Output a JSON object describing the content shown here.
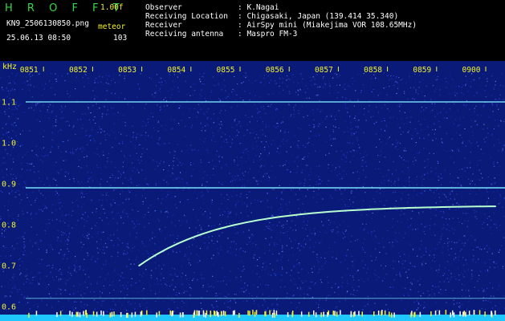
{
  "header": {
    "logo": "H R O F F T",
    "version": "1.00f",
    "filename": "KN9_2506130850.png",
    "datetime": "25.06.13 08:50",
    "mode_label": "meteor",
    "mode_value": "103",
    "info": [
      {
        "label": "Observer",
        "value": ": K.Nagai"
      },
      {
        "label": "Receiving Location",
        "value": ": Chigasaki, Japan (139.414 35.340)"
      },
      {
        "label": "Receiver",
        "value": ": AirSpy mini (Miakejima VOR 108.65MHz)"
      },
      {
        "label": "Receiving antenna",
        "value": ": Maspro FM-3"
      }
    ]
  },
  "spectrogram": {
    "unit_label": "kHz",
    "time_labels": [
      "0851",
      "0852",
      "0853",
      "0854",
      "0855",
      "0856",
      "0857",
      "0858",
      "0859",
      "0900"
    ],
    "freq_labels": [
      "1.1",
      "1.0",
      "0.9",
      "0.8",
      "0.7",
      "0.6"
    ],
    "freq_ticks": [
      1.1,
      1.0,
      0.9,
      0.8,
      0.7,
      0.6
    ],
    "carrier_lines_khz": [
      1.1,
      0.89,
      0.62
    ],
    "meteor_trail": {
      "start": {
        "minute": 2.75,
        "khz": 0.7
      },
      "end": {
        "minute": 10.0,
        "khz": 0.845
      }
    },
    "colors": {
      "background": "#0a1a78",
      "noise_light": "#4a6cff",
      "carrier": "#7ee8ff",
      "trail": "#b8ffd0",
      "axis_text": "#f2f22c",
      "bottom_bar": "#1ec8ff"
    }
  }
}
